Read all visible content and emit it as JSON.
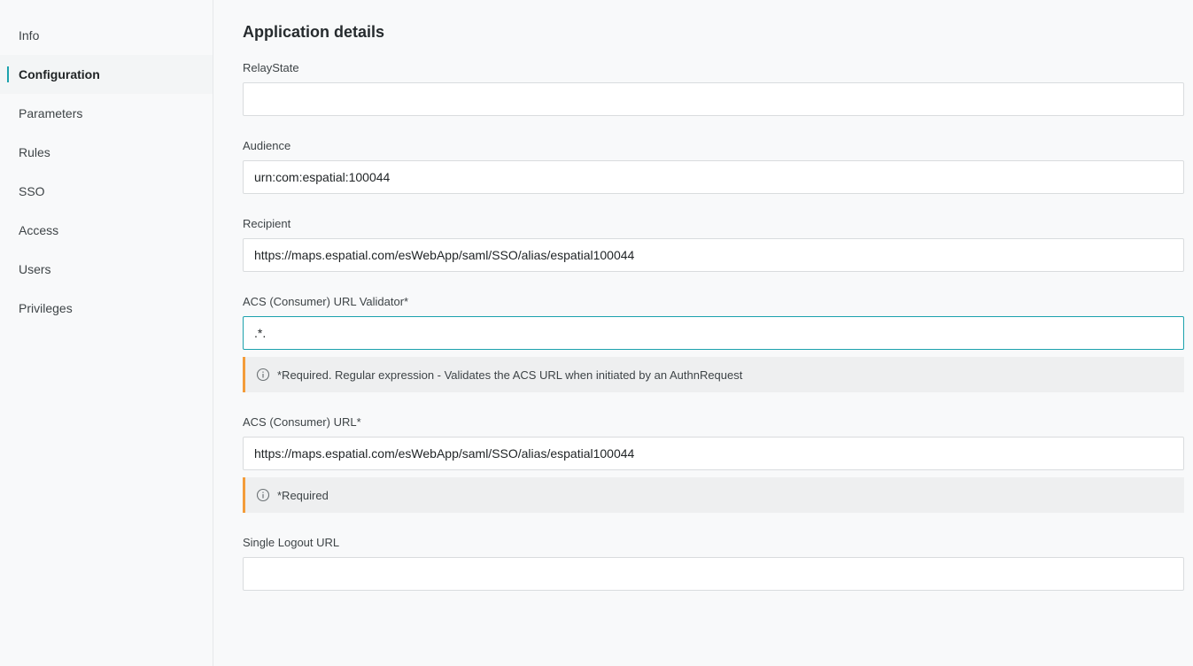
{
  "sidebar": {
    "items": [
      {
        "label": "Info",
        "active": false
      },
      {
        "label": "Configuration",
        "active": true
      },
      {
        "label": "Parameters",
        "active": false
      },
      {
        "label": "Rules",
        "active": false
      },
      {
        "label": "SSO",
        "active": false
      },
      {
        "label": "Access",
        "active": false
      },
      {
        "label": "Users",
        "active": false
      },
      {
        "label": "Privileges",
        "active": false
      }
    ]
  },
  "main": {
    "title": "Application details",
    "fields": {
      "relay_state": {
        "label": "RelayState",
        "value": ""
      },
      "audience": {
        "label": "Audience",
        "value": "urn:com:espatial:100044"
      },
      "recipient": {
        "label": "Recipient",
        "value": "https://maps.espatial.com/esWebApp/saml/SSO/alias/espatial100044"
      },
      "acs_validator": {
        "label": "ACS (Consumer) URL Validator*",
        "value": ".*.",
        "hint": "*Required. Regular expression - Validates the ACS URL when initiated by an AuthnRequest"
      },
      "acs_url": {
        "label": "ACS (Consumer) URL*",
        "value": "https://maps.espatial.com/esWebApp/saml/SSO/alias/espatial100044",
        "hint": "*Required"
      },
      "single_logout": {
        "label": "Single Logout URL",
        "value": ""
      }
    }
  },
  "colors": {
    "accent": "#1ca2ad",
    "hint_border": "#f39c3a"
  },
  "icons": {
    "hint": "info-circle-icon"
  }
}
